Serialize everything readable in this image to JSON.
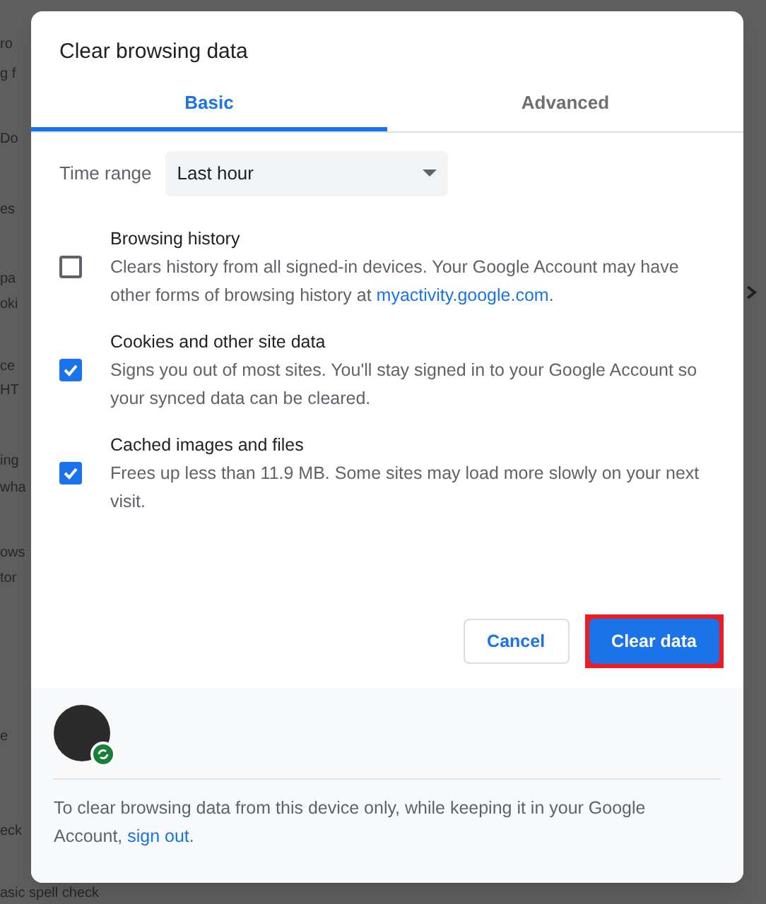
{
  "background_fragments": [
    {
      "text": "ro"
    },
    {
      "text": "g f"
    },
    {
      "text": "Do"
    },
    {
      "text": "es"
    },
    {
      "text": "pa"
    },
    {
      "text": "oki"
    },
    {
      "text": "ce"
    },
    {
      "text": "HT"
    },
    {
      "text": "ing"
    },
    {
      "text": "wha"
    },
    {
      "text": "ows"
    },
    {
      "text": "tor"
    },
    {
      "text": "e"
    },
    {
      "text": "eck"
    }
  ],
  "bottom_fragment": "asic spell check",
  "dialog": {
    "title": "Clear browsing data",
    "tabs": [
      {
        "label": "Basic",
        "selected": true
      },
      {
        "label": "Advanced",
        "selected": false
      }
    ],
    "time_range": {
      "label": "Time range",
      "value": "Last hour"
    },
    "options": [
      {
        "title": "Browsing history",
        "description": "Clears history from all signed-in devices. Your Google Account may have other forms of browsing history at ",
        "link": "myactivity.google.com",
        "description_end": ".",
        "checked": false
      },
      {
        "title": "Cookies and other site data",
        "description": "Signs you out of most sites. You'll stay signed in to your Google Account so your synced data can be cleared.",
        "checked": true
      },
      {
        "title": "Cached images and files",
        "description": "Frees up less than 11.9 MB. Some sites may load more slowly on your next visit.",
        "checked": true
      }
    ],
    "buttons": [
      {
        "label": "Cancel",
        "kind": "secondary",
        "highlighted": false
      },
      {
        "label": "Clear data",
        "kind": "primary",
        "highlighted": true
      }
    ],
    "footer": {
      "text": "To clear browsing data from this device only, while keeping it in your Google Account, ",
      "link": "sign out",
      "text_end": "."
    }
  }
}
